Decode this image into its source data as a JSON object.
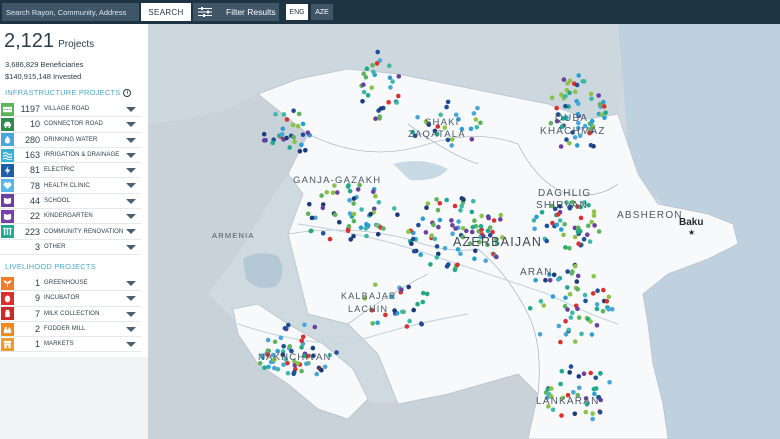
{
  "topbar": {
    "search_placeholder": "Search Rayon, Community, Address",
    "search_label": "SEARCH",
    "filter_label": "Filter Results",
    "lang_eng": "ENG",
    "lang_aze": "AZE"
  },
  "summary": {
    "projects_count": "2,121",
    "projects_word": "Projects",
    "beneficiaries": "3,686,829 Beneficiaries",
    "invested": "$140,915,148 Invested"
  },
  "infrastructure": {
    "title": "INFRASTRUCTURE PROJECTS",
    "items": [
      {
        "count": "1197",
        "label": "VILLAGE ROAD",
        "color": "#5fb35c",
        "icon": "road-icon"
      },
      {
        "count": "10",
        "label": "CONNECTOR ROAD",
        "color": "#2f8a4f",
        "icon": "car-icon"
      },
      {
        "count": "280",
        "label": "DRINKING WATER",
        "color": "#4aa6d8",
        "icon": "water-drop-icon"
      },
      {
        "count": "163",
        "label": "IRRIGATION & DRAINAGE",
        "color": "#38b0d0",
        "icon": "waves-icon"
      },
      {
        "count": "81",
        "label": "ELECTRIC",
        "color": "#1e5fa8",
        "icon": "lightning-icon"
      },
      {
        "count": "78",
        "label": "HEALTH CLINIC",
        "color": "#58b7e6",
        "icon": "heart-icon"
      },
      {
        "count": "44",
        "label": "SCHOOL",
        "color": "#6b3fa0",
        "icon": "book-icon"
      },
      {
        "count": "22",
        "label": "KINDERGARTEN",
        "color": "#7a3fa8",
        "icon": "blocks-icon"
      },
      {
        "count": "223",
        "label": "COMMUNITY RENOVATION",
        "color": "#22a88a",
        "icon": "building-icon"
      },
      {
        "count": "3",
        "label": "OTHER",
        "color": "#ffffff",
        "icon": "none"
      }
    ]
  },
  "livelihood": {
    "title": "LIVELIHOOD PROJECTS",
    "items": [
      {
        "count": "1",
        "label": "GREENHOUSE",
        "color": "#ef7d2b",
        "icon": "sprout-icon"
      },
      {
        "count": "9",
        "label": "INCUBATOR",
        "color": "#d9322e",
        "icon": "egg-icon"
      },
      {
        "count": "7",
        "label": "MILK COLLECTION",
        "color": "#cc2a2a",
        "icon": "milk-icon"
      },
      {
        "count": "2",
        "label": "FODDER MILL",
        "color": "#f08a1c",
        "icon": "mill-icon"
      },
      {
        "count": "1",
        "label": "MARKETS",
        "color": "#ef9a2a",
        "icon": "market-icon"
      }
    ]
  },
  "map": {
    "labels": {
      "shaki": "SHAKI",
      "zaqatala": "ZAQATALA",
      "quba": "QUBA",
      "khachmaz": "KHACHMAZ",
      "ganja": "GANJA-GAZAKH",
      "daghlig": "DAGHLIG",
      "shirvan": "SHIRVAN",
      "absheron": "ABSHERON",
      "baku": "Baku",
      "azerbaijan": "AZERBAIJAN",
      "armenia": "ARMENIA",
      "aran": "ARAN",
      "kalbajar": "KALBAJAR",
      "lachin": "LACHIN",
      "nakhchivan": "NAKHCHIVAN",
      "lankaran": "LANKARAN"
    },
    "dot_colors": [
      "#8bc34a",
      "#5fb35c",
      "#3fb8a8",
      "#4aa6d8",
      "#2a9fd6",
      "#1e4f9a",
      "#1b3a7a",
      "#22a88a",
      "#6b3fa0",
      "#d9322e"
    ]
  }
}
